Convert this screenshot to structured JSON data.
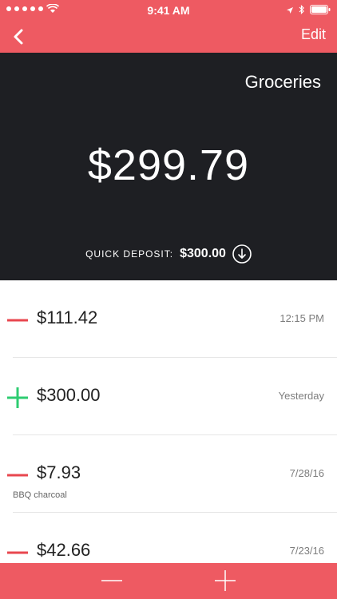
{
  "status": {
    "time": "9:41 AM"
  },
  "nav": {
    "edit_label": "Edit"
  },
  "account": {
    "category": "Groceries",
    "balance": "$299.79",
    "quick_deposit_label": "QUICK DEPOSIT:",
    "quick_deposit_amount": "$300.00"
  },
  "transactions": [
    {
      "type": "withdrawal",
      "amount": "$111.42",
      "date": "12:15 PM",
      "note": ""
    },
    {
      "type": "deposit",
      "amount": "$300.00",
      "date": "Yesterday",
      "note": ""
    },
    {
      "type": "withdrawal",
      "amount": "$7.93",
      "date": "7/28/16",
      "note": "BBQ charcoal"
    },
    {
      "type": "withdrawal",
      "amount": "$42.66",
      "date": "7/23/16",
      "note": ""
    }
  ],
  "colors": {
    "accent": "#ee5a62",
    "header_bg": "#1e1f23",
    "withdrawal": "#e8474f",
    "deposit": "#2ecc71"
  },
  "icons": {
    "back": "chevron-left-icon",
    "quick_deposit": "arrow-down-circle-icon",
    "withdrawal": "minus-icon",
    "deposit": "plus-icon"
  }
}
